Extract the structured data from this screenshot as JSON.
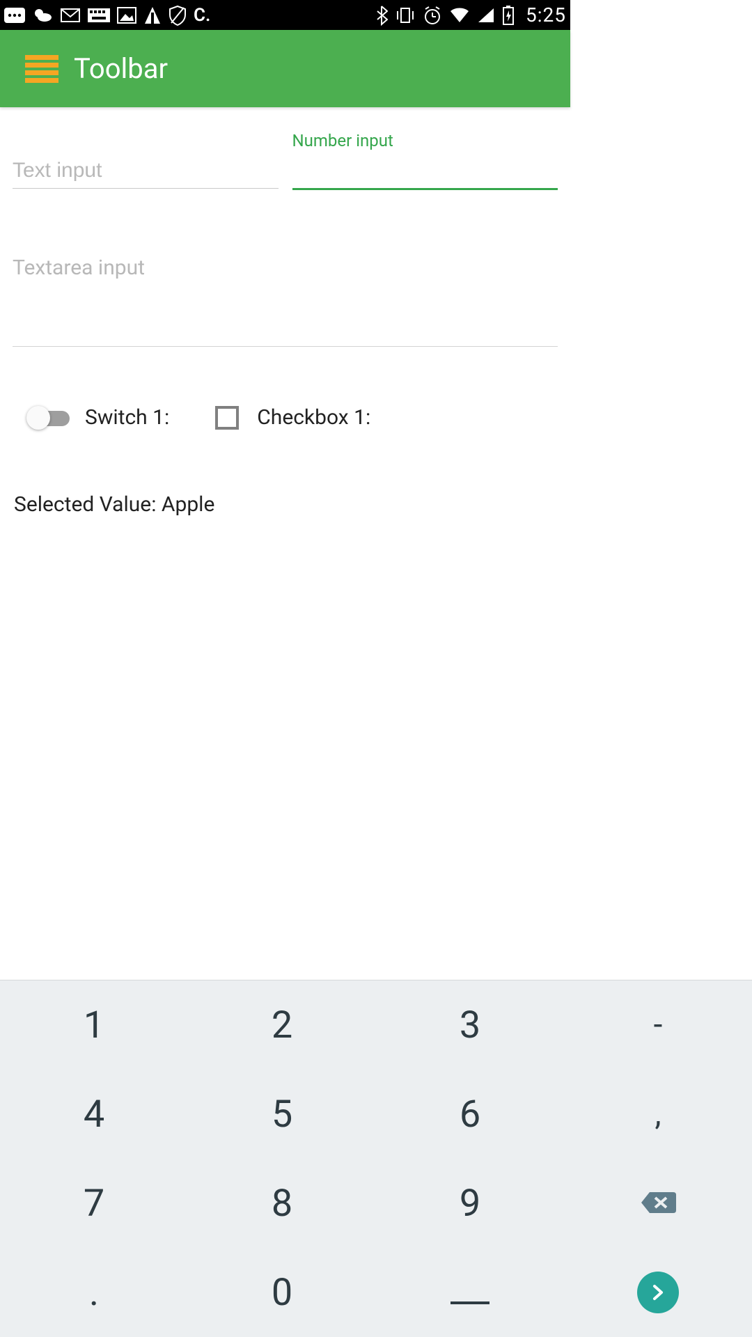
{
  "status": {
    "time": "5:25"
  },
  "toolbar": {
    "title": "Toolbar"
  },
  "form": {
    "text_input_placeholder": "Text input",
    "number_input_label": "Number input",
    "number_input_value": "",
    "textarea_placeholder": "Textarea input",
    "switch_label": "Switch 1:",
    "checkbox_label": "Checkbox 1:",
    "selected_value_text": "Selected Value: Apple"
  },
  "keypad": {
    "keys": [
      "1",
      "2",
      "3",
      "-",
      "4",
      "5",
      "6",
      ",",
      "7",
      "8",
      "9",
      "bksp",
      ".",
      "0",
      "_",
      "go"
    ]
  }
}
